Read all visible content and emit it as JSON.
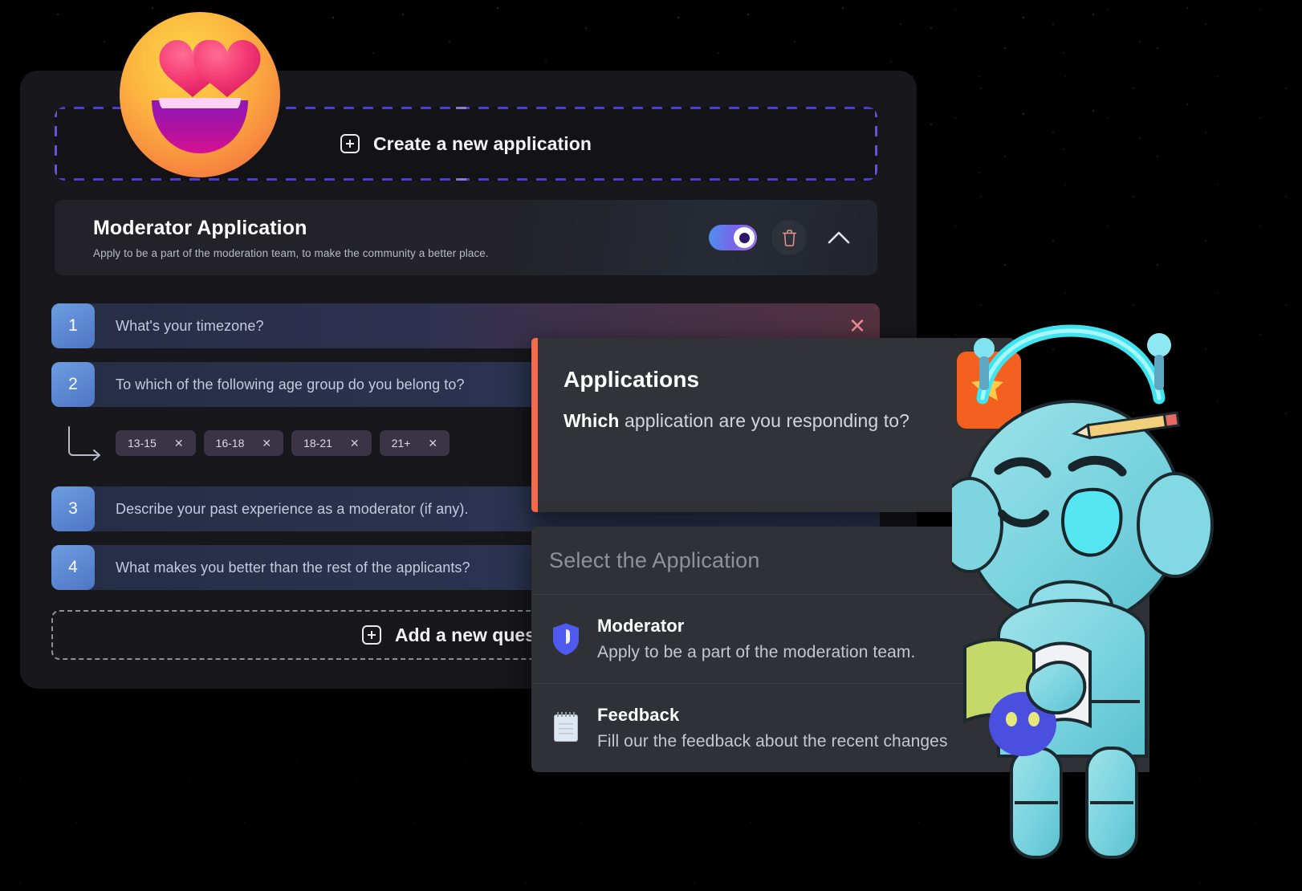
{
  "create_application": {
    "icon": "plus-square-icon",
    "label": "Create a new application"
  },
  "application_header": {
    "title": "Moderator Application",
    "description": "Apply to be a part of the moderation team, to make the community a better place.",
    "toggle_state": "on",
    "delete_icon": "trash-icon",
    "collapse_icon": "chevron-up-icon"
  },
  "questions": [
    {
      "number": "1",
      "text": "What's your timezone?",
      "close_icon": "close-icon",
      "highlight": "danger"
    },
    {
      "number": "2",
      "text": "To which of the following age group do you belong to?",
      "highlight": "plain"
    },
    {
      "number": "3",
      "text": "Describe your past experience as a moderator (if any).",
      "highlight": "plain"
    },
    {
      "number": "4",
      "text": "What makes you better than the rest of the applicants?",
      "highlight": "plain"
    }
  ],
  "answer_chips": [
    {
      "label": "13-15",
      "remove_icon": "close-icon"
    },
    {
      "label": "16-18",
      "remove_icon": "close-icon"
    },
    {
      "label": "18-21",
      "remove_icon": "close-icon"
    },
    {
      "label": "21+",
      "remove_icon": "close-icon"
    }
  ],
  "add_question": {
    "icon": "plus-square-icon",
    "label": "Add a new question"
  },
  "applications_panel": {
    "title": "Applications",
    "question_strong": "Which",
    "question_rest": " application are you responding to?",
    "accent_color": "#f26b4e"
  },
  "application_dropdown": {
    "placeholder": "Select the Application",
    "options": [
      {
        "icon": "shield-icon",
        "title": "Moderator",
        "description": "Apply to be a part of the moderation team."
      },
      {
        "icon": "notepad-icon",
        "title": "Feedback",
        "description": "Fill our the feedback about the recent changes"
      }
    ]
  },
  "decorations": {
    "emoji": "heart-eyes-emoji",
    "mascot": "wumpus-mascot-reading"
  },
  "colors": {
    "accent_orange": "#f26b4e",
    "dashed_purple": "#4b3ed8",
    "question_blue": "#5f8bd4",
    "danger_red": "#ef8e94",
    "card_bg": "#17171c",
    "panel_bg": "#313338"
  }
}
